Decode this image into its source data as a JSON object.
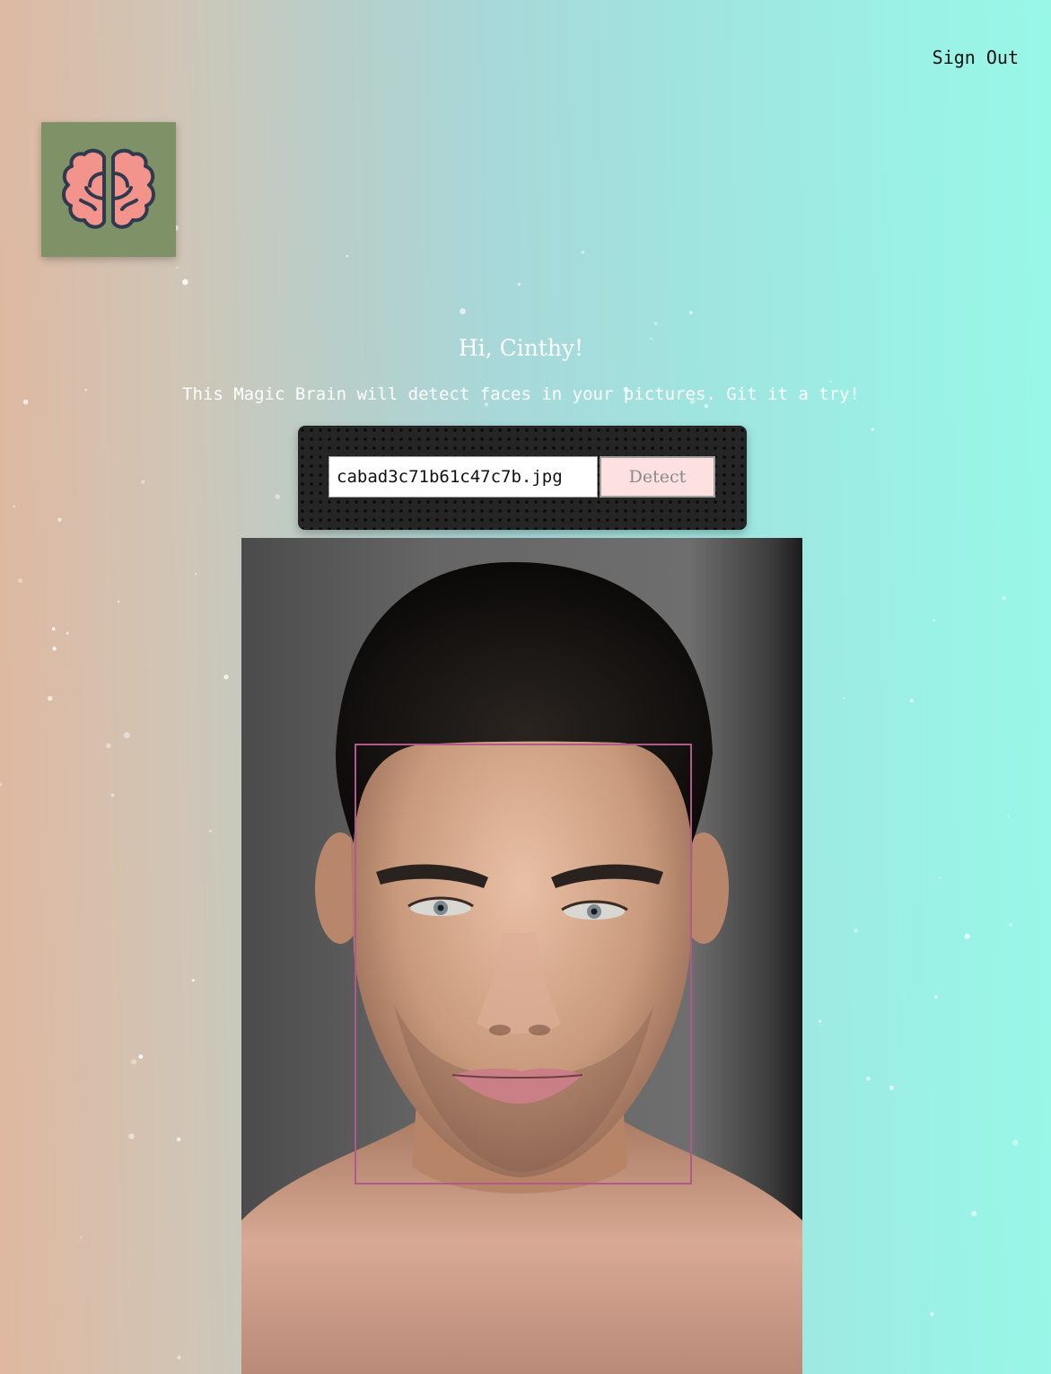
{
  "nav": {
    "signout_label": "Sign Out"
  },
  "logo": {
    "icon": "brain-icon",
    "bg_color": "#7f9166",
    "icon_color": "#f2938c"
  },
  "header": {
    "greeting": "Hi, Cinthy!",
    "tagline": "This Magic Brain will detect faces in your pictures. Git it a try!"
  },
  "form": {
    "url_value": "cabad3c71b61c47c7b.jpg",
    "detect_label": "Detect"
  },
  "result": {
    "image_subject": "portrait photo",
    "face_box_color": "#b05a8a"
  }
}
